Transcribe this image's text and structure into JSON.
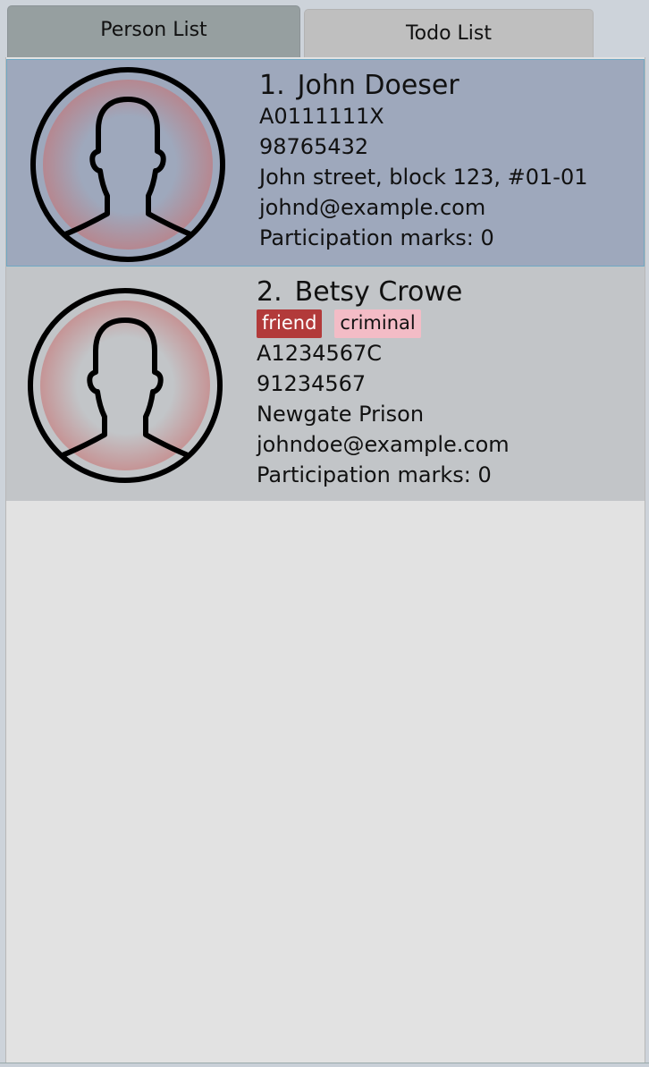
{
  "tabs": [
    {
      "label": "Person List",
      "active": true
    },
    {
      "label": "Todo List",
      "active": false
    }
  ],
  "persons": [
    {
      "index": "1.",
      "name": "John Doeser",
      "tags": [],
      "matric": "A0111111X",
      "phone": "98765432",
      "address": "John street, block 123, #01-01",
      "email": "johnd@example.com",
      "participation": "Participation marks: 0"
    },
    {
      "index": "2.",
      "name": "Betsy Crowe",
      "tags": [
        {
          "label": "friend",
          "bg": "#b23a3a",
          "fg": "#ffffff"
        },
        {
          "label": "criminal",
          "bg": "#f3bcc6",
          "fg": "#111111"
        }
      ],
      "matric": "A1234567C",
      "phone": "91234567",
      "address": "Newgate Prison",
      "email": "johndoe@example.com",
      "participation": "Participation marks: 0"
    }
  ],
  "icons": {
    "avatar": "person-silhouette-icon"
  },
  "colors": {
    "selected_card": "#9ea8bc",
    "normal_card": "#c2c5c8",
    "list_background": "#e2e2e2"
  }
}
